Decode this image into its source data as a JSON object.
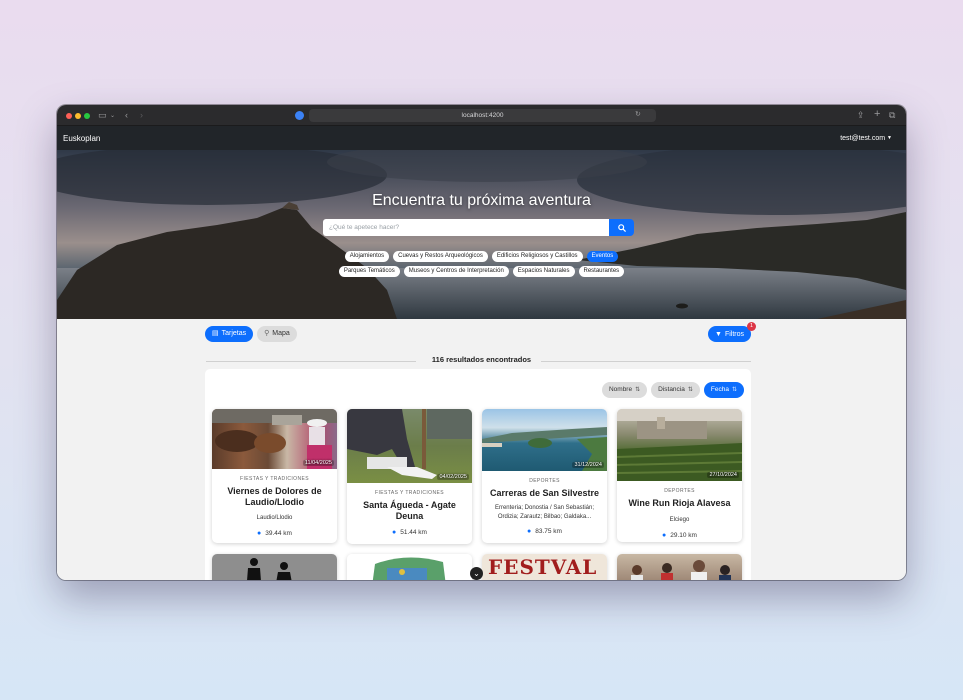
{
  "browser": {
    "url": "localhost:4200"
  },
  "navbar": {
    "brand": "Euskoplan",
    "user": "test@test.com"
  },
  "hero": {
    "title": "Encuentra tu próxima aventura",
    "search_placeholder": "¿Qué te apetece hacer?",
    "chips_row1": [
      {
        "label": "Alojamientos",
        "active": false
      },
      {
        "label": "Cuevas y Restos Arqueológicos",
        "active": false
      },
      {
        "label": "Edificios Religiosos y Castillos",
        "active": false
      },
      {
        "label": "Eventos",
        "active": true
      }
    ],
    "chips_row2": [
      {
        "label": "Parques Temáticos",
        "active": false
      },
      {
        "label": "Museos y Centros de Interpretación",
        "active": false
      },
      {
        "label": "Espacios Naturales",
        "active": false
      },
      {
        "label": "Restaurantes",
        "active": false
      }
    ]
  },
  "toolbar": {
    "view_cards": "Tarjetas",
    "view_map": "Mapa",
    "filters": "Filtros",
    "filters_count": "1"
  },
  "results": {
    "text": "116 resultados encontrados"
  },
  "sort": {
    "name": "Nombre",
    "distance": "Distancia",
    "date": "Fecha",
    "active": "Fecha"
  },
  "cards": [
    {
      "date": "11/04/2025",
      "category": "FIESTAS Y TRADICIONES",
      "title": "Viernes de Dolores de Laudio/Llodio",
      "location": "Laudio/Llodio",
      "distance": "39.44 km"
    },
    {
      "date": "04/02/2025",
      "category": "FIESTAS Y TRADICIONES",
      "title": "Santa Águeda - Agate Deuna",
      "location": "",
      "distance": "51.44 km"
    },
    {
      "date": "31/12/2024",
      "category": "DEPORTES",
      "title": "Carreras de San Silvestre",
      "location": "Errenteria; Donostia / San Sebastián; Ordizia; Zarautz; Bilbao; Galdaka...",
      "distance": "83.75 km"
    },
    {
      "date": "27/10/2024",
      "category": "DEPORTES",
      "title": "Wine Run Rioja Alavesa",
      "location": "Elciego",
      "distance": "29.10 km"
    }
  ],
  "second_row_cards": [
    {
      "title": "FESTVAL"
    }
  ]
}
